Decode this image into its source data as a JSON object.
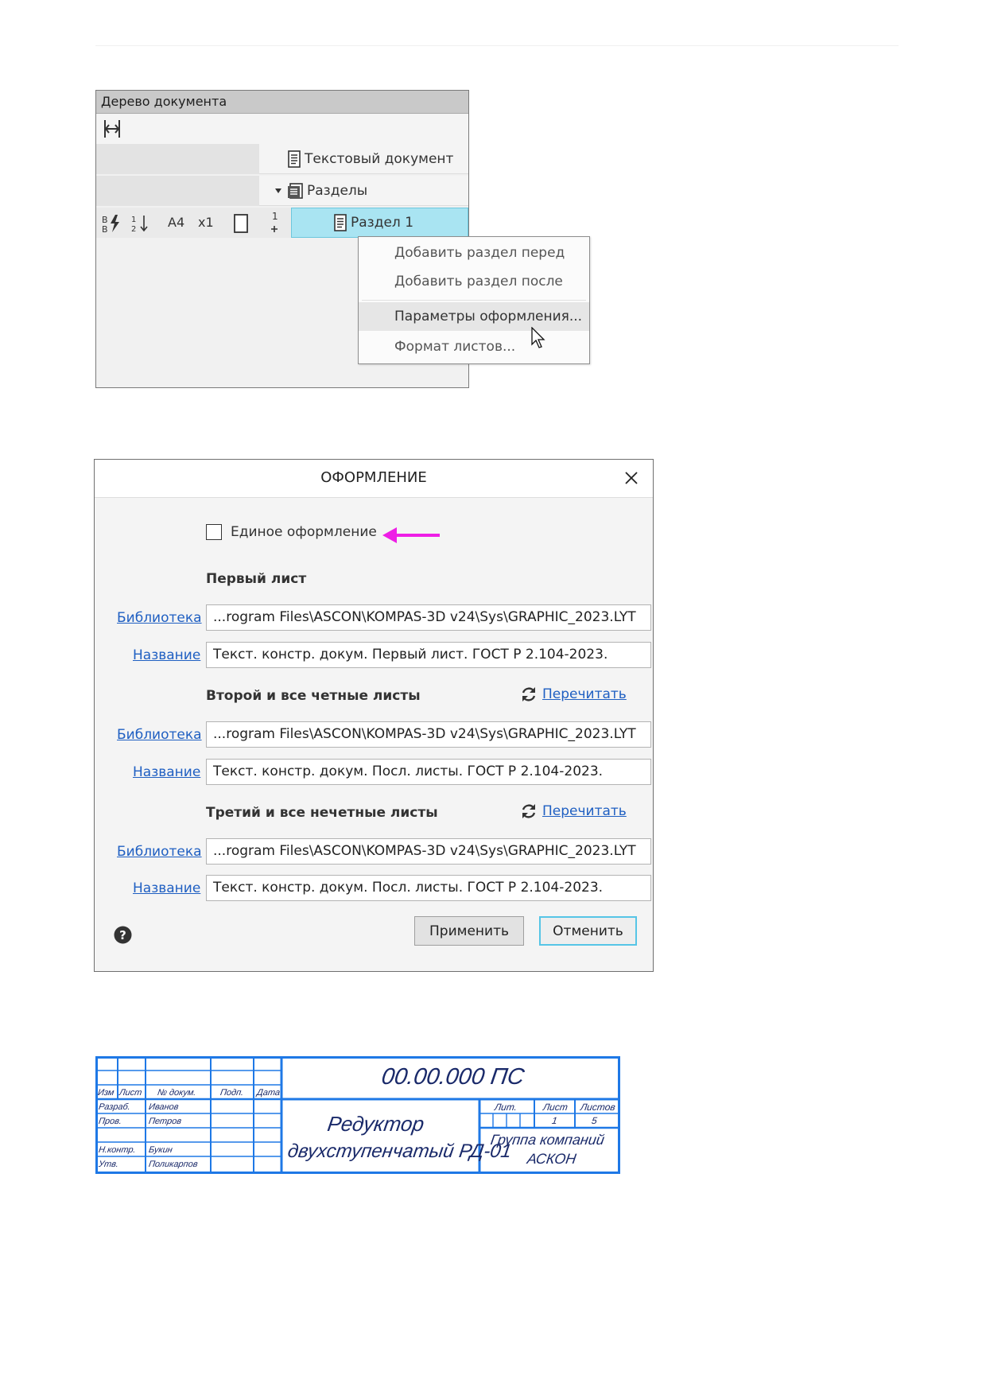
{
  "tree": {
    "title": "Дерево документа",
    "root_label": "Текстовый документ",
    "sections_label": "Разделы",
    "section_label": "Раздел 1",
    "props": {
      "format": "A4",
      "scale": "x1",
      "num_top": "1"
    }
  },
  "context_menu": {
    "items": [
      "Добавить раздел перед",
      "Добавить раздел после",
      "Параметры оформления...",
      "Формат листов..."
    ]
  },
  "dialog": {
    "title": "ОФОРМЛЕНИЕ",
    "unified_label": "Единое оформление",
    "unified_checked": false,
    "library_link": "Библиотека",
    "name_link": "Название",
    "reread_link": "Перечитать",
    "sections": [
      {
        "title": "Первый лист",
        "library": "...rogram Files\\ASCON\\KOMPAS-3D v24\\Sys\\GRAPHIC_2023.LYT",
        "name": "Текст. констр. докум. Первый лист. ГОСТ Р 2.104-2023."
      },
      {
        "title": "Второй и все четные листы",
        "library": "...rogram Files\\ASCON\\KOMPAS-3D v24\\Sys\\GRAPHIC_2023.LYT",
        "name": "Текст. констр. докум. Посл. листы. ГОСТ Р 2.104-2023."
      },
      {
        "title": "Третий и все нечетные листы",
        "library": "...rogram Files\\ASCON\\KOMPAS-3D v24\\Sys\\GRAPHIC_2023.LYT",
        "name": "Текст. констр. докум. Посл. листы. ГОСТ Р 2.104-2023."
      }
    ],
    "apply_label": "Применить",
    "cancel_label": "Отменить"
  },
  "stamp": {
    "designation": "00.00.000 ПС",
    "name_line1": "Редуктор",
    "name_line2": "двухступенчатый РД-01",
    "company_line1": "Группа компаний",
    "company_line2": "АСКОН",
    "col_headers": [
      "Изм",
      "Лист",
      "№ докум.",
      "Подп.",
      "Дата"
    ],
    "roles": [
      "Разраб.",
      "Пров.",
      "",
      "Н.контр.",
      "Утв."
    ],
    "people": [
      "Иванов",
      "Петров",
      "",
      "Букин",
      "Поликарпов"
    ],
    "lit_label": "Лит.",
    "sheet_label": "Лист",
    "sheets_label": "Листов",
    "sheet_value": "1",
    "sheets_value": "5",
    "line_color": "#1e78e6"
  }
}
